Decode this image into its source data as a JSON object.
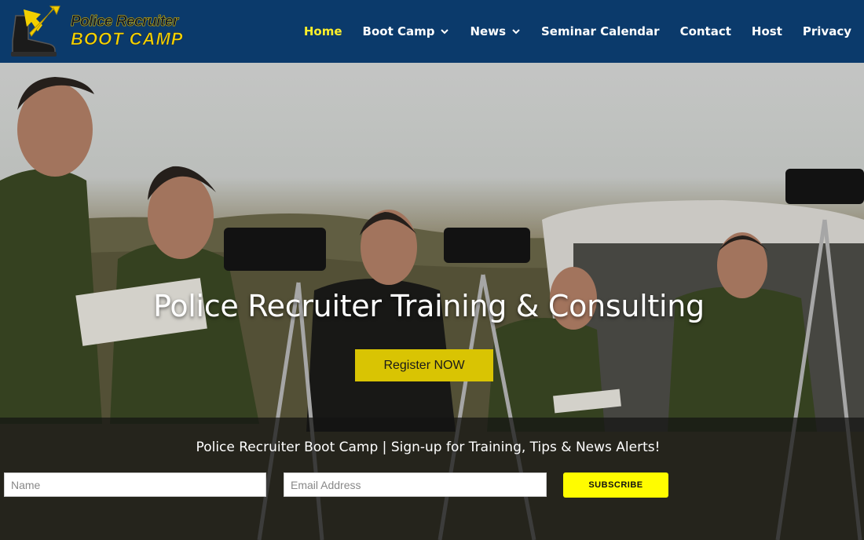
{
  "brand": {
    "line1": "Police Recruiter",
    "line2": "BOOT CAMP",
    "colors": {
      "header_bg": "#0b3a6b",
      "accent_yellow": "#ffef2b"
    }
  },
  "nav": {
    "items": [
      {
        "label": "Home",
        "active": true,
        "has_dropdown": false
      },
      {
        "label": "Boot Camp",
        "active": false,
        "has_dropdown": true
      },
      {
        "label": "News",
        "active": false,
        "has_dropdown": true
      },
      {
        "label": "Seminar Calendar",
        "active": false,
        "has_dropdown": false
      },
      {
        "label": "Contact",
        "active": false,
        "has_dropdown": false
      },
      {
        "label": "Host",
        "active": false,
        "has_dropdown": false
      },
      {
        "label": "Privacy",
        "active": false,
        "has_dropdown": false
      }
    ]
  },
  "hero": {
    "title": "Police Recruiter Training & Consulting",
    "register_label": "Register NOW"
  },
  "signup": {
    "heading": "Police Recruiter Boot Camp | Sign-up for Training, Tips & News Alerts!",
    "name_placeholder": "Name",
    "email_placeholder": "Email Address",
    "subscribe_label": "SUBSCRIBE"
  }
}
